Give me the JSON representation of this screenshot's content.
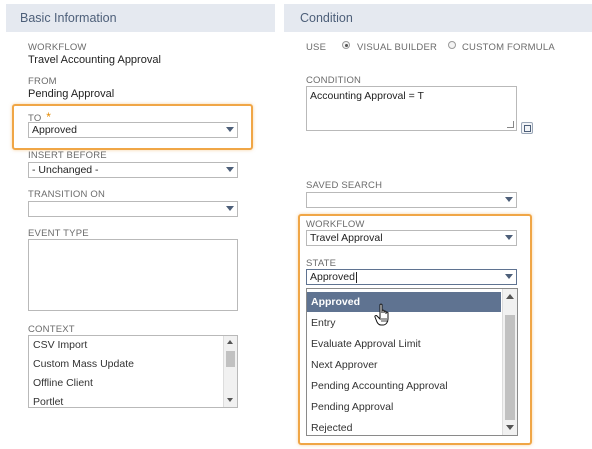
{
  "basic": {
    "header": "Basic Information",
    "workflow_label": "WORKFLOW",
    "workflow_value": "Travel Accounting Approval",
    "from_label": "FROM",
    "from_value": "Pending Approval",
    "to_label": "TO",
    "to_required": "*",
    "to_value": "Approved",
    "insert_before_label": "INSERT BEFORE",
    "insert_before_value": "- Unchanged -",
    "transition_on_label": "TRANSITION ON",
    "transition_on_value": "",
    "event_type_label": "EVENT TYPE",
    "context_label": "CONTEXT",
    "context_items": [
      "CSV Import",
      "Custom Mass Update",
      "Offline Client",
      "Portlet"
    ]
  },
  "condition": {
    "header": "Condition",
    "use_label": "USE",
    "visual_builder": "VISUAL BUILDER",
    "custom_formula": "CUSTOM FORMULA",
    "use_selected": "visual_builder",
    "condition_label": "CONDITION",
    "condition_value": "Accounting Approval = T",
    "saved_search_label": "SAVED SEARCH",
    "saved_search_value": "",
    "workflow_label": "WORKFLOW",
    "workflow_value": "Travel Approval",
    "state_label": "STATE",
    "state_value": "Approved",
    "state_options": [
      "Approved",
      "Entry",
      "Evaluate Approval Limit",
      "Next Approver",
      "Pending Accounting Approval",
      "Pending Approval",
      "Rejected"
    ],
    "state_highlighted": "Approved"
  },
  "colors": {
    "accent_orange": "#f0a646",
    "header_bg": "#e5e9f0",
    "header_text": "#4d5f79",
    "highlight_bg": "#5f7391",
    "required": "#e58a00"
  },
  "icons": [
    "dropdown-arrow-icon",
    "expand-icon",
    "hand-cursor-icon",
    "radio-icon"
  ]
}
